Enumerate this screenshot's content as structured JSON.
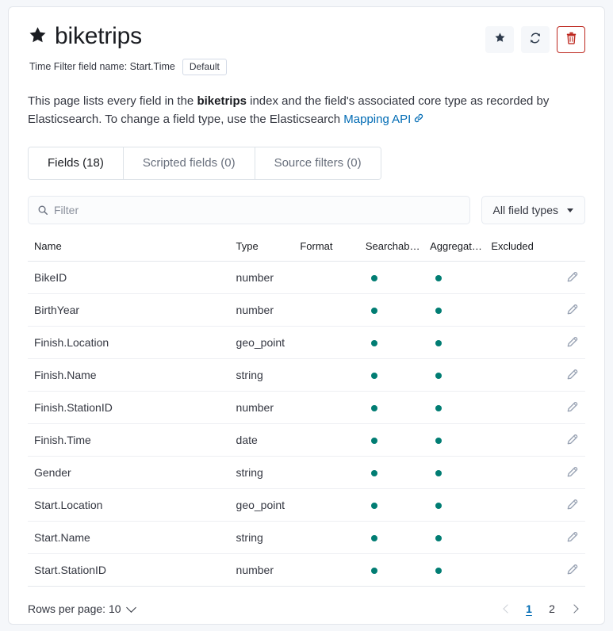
{
  "header": {
    "star_icon": "star-filled-icon",
    "index_title": "biketrips",
    "time_filter_label": "Time Filter field name: Start.Time",
    "default_badge": "Default",
    "actions": [
      {
        "name": "favorite-button",
        "icon": "star-filled-icon"
      },
      {
        "name": "refresh-button",
        "icon": "refresh-icon"
      },
      {
        "name": "delete-button",
        "icon": "trash-icon"
      }
    ],
    "danger_color": "#BD271E"
  },
  "description": {
    "part1": "This page lists every field in the ",
    "index_name": "biketrips",
    "part2": " index and the field's associated core type as recorded by Elasticsearch. To change a field type, use the Elasticsearch ",
    "link_text": "Mapping API",
    "link_icon": "external-link-icon",
    "link_color": "#006BB4"
  },
  "tabs": [
    {
      "label": "Fields (18)",
      "active": true
    },
    {
      "label": "Scripted fields (0)",
      "active": false
    },
    {
      "label": "Source filters (0)",
      "active": false
    }
  ],
  "filter": {
    "search_icon": "search-icon",
    "placeholder": "Filter",
    "value": "",
    "dropdown_label": "All field types",
    "dropdown_icon": "chevron-down-icon"
  },
  "table": {
    "columns": [
      "Name",
      "Type",
      "Format",
      "Searchab…",
      "Aggregat…",
      "Excluded"
    ],
    "dot_color": "#017D73",
    "edit_icon": "pencil-icon",
    "rows": [
      {
        "name": "BikeID",
        "type": "number",
        "format": "",
        "searchable": true,
        "aggregatable": true,
        "excluded": ""
      },
      {
        "name": "BirthYear",
        "type": "number",
        "format": "",
        "searchable": true,
        "aggregatable": true,
        "excluded": ""
      },
      {
        "name": "Finish.Location",
        "type": "geo_point",
        "format": "",
        "searchable": true,
        "aggregatable": true,
        "excluded": ""
      },
      {
        "name": "Finish.Name",
        "type": "string",
        "format": "",
        "searchable": true,
        "aggregatable": true,
        "excluded": ""
      },
      {
        "name": "Finish.StationID",
        "type": "number",
        "format": "",
        "searchable": true,
        "aggregatable": true,
        "excluded": ""
      },
      {
        "name": "Finish.Time",
        "type": "date",
        "format": "",
        "searchable": true,
        "aggregatable": true,
        "excluded": ""
      },
      {
        "name": "Gender",
        "type": "string",
        "format": "",
        "searchable": true,
        "aggregatable": true,
        "excluded": ""
      },
      {
        "name": "Start.Location",
        "type": "geo_point",
        "format": "",
        "searchable": true,
        "aggregatable": true,
        "excluded": ""
      },
      {
        "name": "Start.Name",
        "type": "string",
        "format": "",
        "searchable": true,
        "aggregatable": true,
        "excluded": ""
      },
      {
        "name": "Start.StationID",
        "type": "number",
        "format": "",
        "searchable": true,
        "aggregatable": true,
        "excluded": ""
      }
    ]
  },
  "footer": {
    "rows_per_page_label": "Rows per page: 10",
    "pages": [
      {
        "label": "1",
        "active": true
      },
      {
        "label": "2",
        "active": false
      }
    ],
    "prev_icon": "chevron-left-icon",
    "next_icon": "chevron-right-icon",
    "active_color": "#006BB4"
  }
}
